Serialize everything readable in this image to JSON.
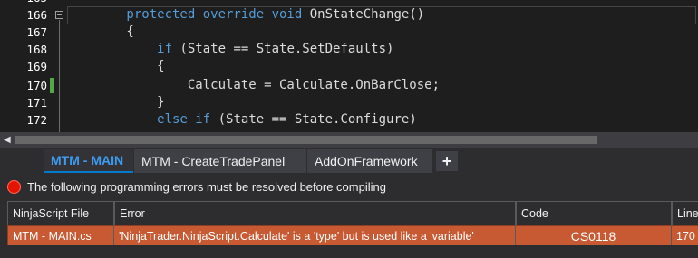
{
  "editor": {
    "lines": [
      {
        "num": "166",
        "code": "        protected override void OnStateChange()"
      },
      {
        "num": "167",
        "code": "        {"
      },
      {
        "num": "168",
        "code": "            if (State == State.SetDefaults)"
      },
      {
        "num": "169",
        "code": "            {"
      },
      {
        "num": "170",
        "code": "                Calculate = Calculate.OnBarClose;"
      },
      {
        "num": "171",
        "code": "            }"
      },
      {
        "num": "172",
        "code": "            else if (State == State.Configure)"
      }
    ]
  },
  "tabs": [
    {
      "label": "MTM - MAIN",
      "active": true
    },
    {
      "label": "MTM - CreateTradePanel",
      "active": false
    },
    {
      "label": "AddOnFramework",
      "active": false
    }
  ],
  "add_tab_label": "+",
  "errors": {
    "message": "The following programming errors must be resolved before compiling",
    "columns": [
      "NinjaScript File",
      "Error",
      "Code",
      "Line"
    ],
    "rows": [
      {
        "file": "MTM - MAIN.cs",
        "error": "'NinjaTrader.NinjaScript.Calculate' is a 'type' but is used like a 'variable'",
        "code": "CS0118",
        "line": "170"
      }
    ]
  },
  "colors": {
    "editor_bg": "#1e1e1e",
    "keyword": "#569cd6",
    "active_tab_text": "#3d9cf0",
    "error_row_bg": "#c75a32",
    "error_icon": "#e51400",
    "change_marker": "#57a64a"
  }
}
